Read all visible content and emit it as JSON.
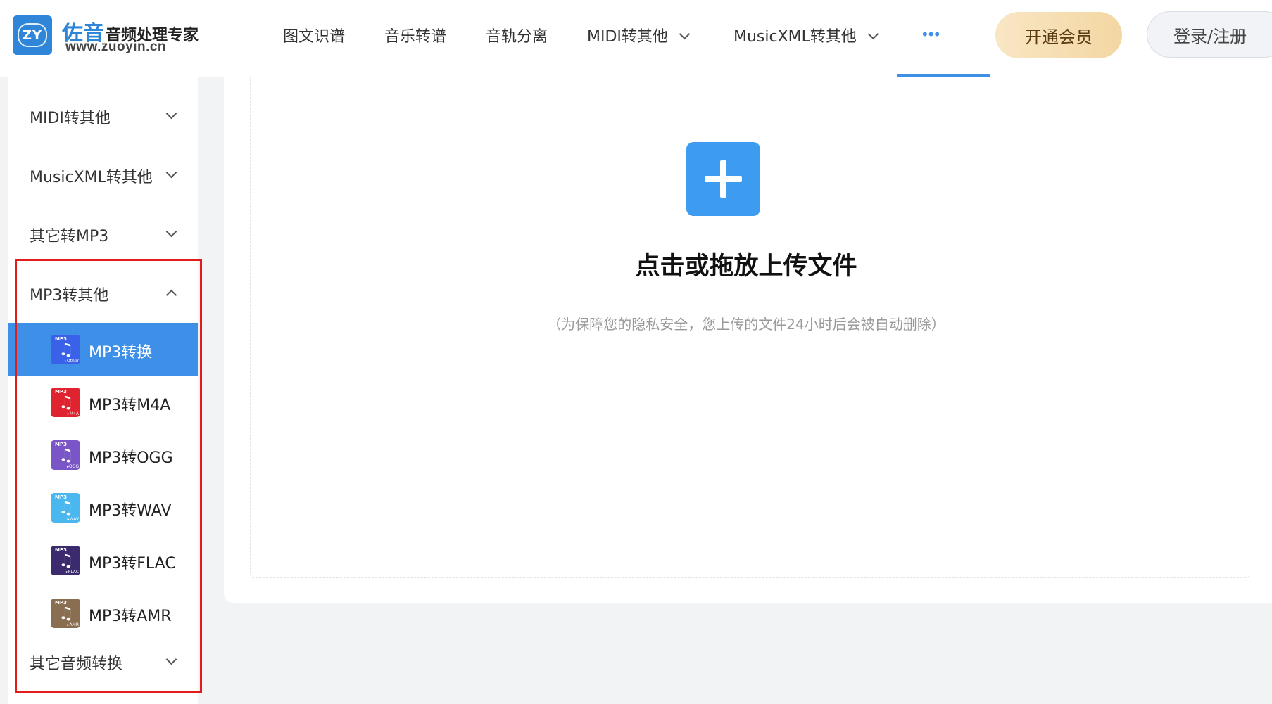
{
  "header": {
    "logo_mark": "ZY",
    "brand_name": "佐音",
    "brand_tagline": "音频处理专家",
    "brand_url": "www.zuoyin.cn",
    "nav": [
      {
        "label": "图文识谱",
        "has_dropdown": false
      },
      {
        "label": "音乐转谱",
        "has_dropdown": false
      },
      {
        "label": "音轨分离",
        "has_dropdown": false
      },
      {
        "label": "MIDI转其他",
        "has_dropdown": true
      },
      {
        "label": "MusicXML转其他",
        "has_dropdown": true
      },
      {
        "label": "•••",
        "has_dropdown": false,
        "active": true
      }
    ],
    "vip_label": "开通会员",
    "login_label": "登录/注册"
  },
  "sidebar": {
    "categories": [
      {
        "label": "MIDI转其他",
        "expanded": false
      },
      {
        "label": "MusicXML转其他",
        "expanded": false
      },
      {
        "label": "其它转MP3",
        "expanded": false
      },
      {
        "label": "MP3转其他",
        "expanded": true
      },
      {
        "label": "其它音频转换",
        "expanded": false
      }
    ],
    "mp3_items": [
      {
        "label": "MP3转换",
        "icon_tag": "MP3",
        "icon_fmt": "▸Other",
        "color": "#3a62e8",
        "active": true
      },
      {
        "label": "MP3转M4A",
        "icon_tag": "MP3",
        "icon_fmt": "▸M4A",
        "color": "#e0242f",
        "active": false
      },
      {
        "label": "MP3转OGG",
        "icon_tag": "MP3",
        "icon_fmt": "▸OGG",
        "color": "#7a55c7",
        "active": false
      },
      {
        "label": "MP3转WAV",
        "icon_tag": "MP3",
        "icon_fmt": "▸WAV",
        "color": "#4ab8ee",
        "active": false
      },
      {
        "label": "MP3转FLAC",
        "icon_tag": "MP3",
        "icon_fmt": "▸FLAC",
        "color": "#3b2a6e",
        "active": false
      },
      {
        "label": "MP3转AMR",
        "icon_tag": "MP3",
        "icon_fmt": "▸AMR",
        "color": "#8a6e52",
        "active": false
      }
    ]
  },
  "main": {
    "upload_title": "点击或拖放上传文件",
    "upload_note": "（为保障您的隐私安全，您上传的文件24小时后会被自动删除）"
  },
  "colors": {
    "accent": "#3d8fe8",
    "highlight_border": "#e21b1b",
    "vip_gold": "#f3d7a2"
  }
}
